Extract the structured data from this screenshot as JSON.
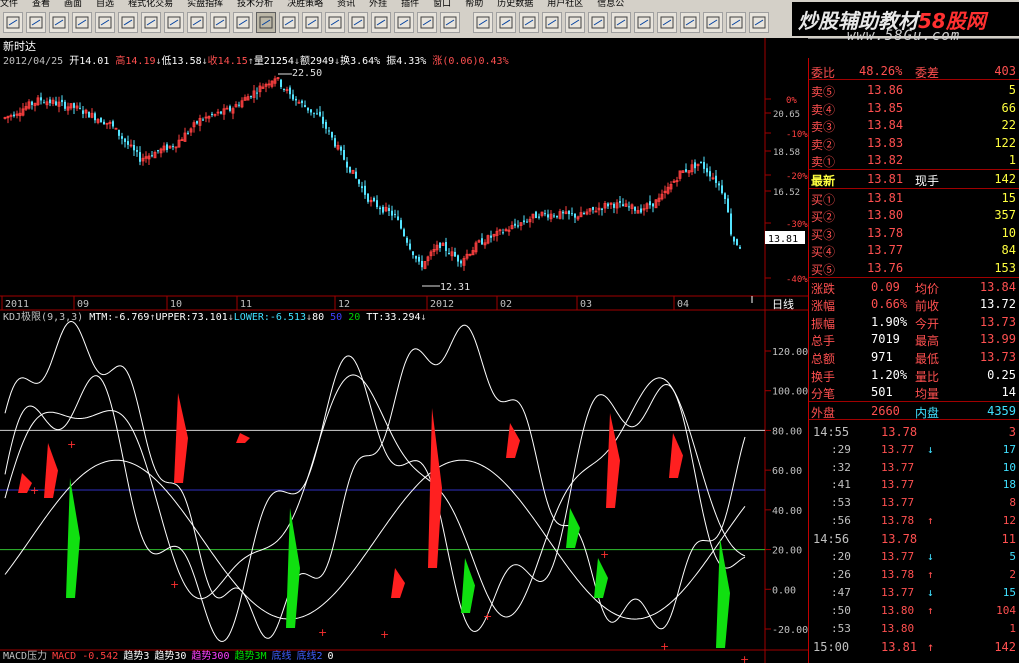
{
  "menu": [
    "文件",
    "查看",
    "画面",
    "自选",
    "程式化交易",
    "实盘指挥",
    "技术分析",
    "决胜策略",
    "资讯",
    "外挂",
    "插件",
    "窗口",
    "帮助",
    "历史数据",
    "用户社区",
    "信息公"
  ],
  "logo": {
    "text_main": "炒股辅助教材",
    "text_red": "58股网",
    "url": "www.58Gu.com"
  },
  "chart": {
    "title": "新时达",
    "info": {
      "date": "2012/04/25",
      "open": "开14.01",
      "high": "高14.19",
      "low": "低13.58",
      "close": "收14.15",
      "vol": "量21254",
      "amt": "额2949",
      "turn": "换3.64%",
      "amp": "振4.33%",
      "chg": "涨(0.06)0.43%"
    },
    "peak_label": "22.50",
    "trough_label": "12.31",
    "right_scale": [
      "0%",
      "20.65",
      "-10%",
      "18.58",
      "-20%",
      "16.52",
      "-30%",
      "13.81",
      "-40%"
    ],
    "last_price": "13.81",
    "months": [
      "2011",
      "09",
      "10",
      "11",
      "12",
      "2012",
      "02",
      "03",
      "04"
    ],
    "period_label": "日线"
  },
  "indicator": {
    "header": "KDJ极限(9,3,3)",
    "mtm": "MTM:-6.769",
    "upper": "UPPER:73.101",
    "lower": "LOWER:-6.513",
    "v80": "80",
    "v50": "50",
    "v20": "20",
    "tt": "TT:33.294",
    "yticks": [
      "120.00",
      "100.00",
      "80.00",
      "60.00",
      "40.00",
      "20.00",
      "0.00",
      "-20.00"
    ]
  },
  "bottom_tabs": [
    {
      "label": "MACD压力",
      "color": "#c0c0c0"
    },
    {
      "label": "MACD -0.542",
      "color": "#ff4040"
    },
    {
      "label": "趋势3",
      "color": "#ffffff"
    },
    {
      "label": "趋势30",
      "color": "#ffffff"
    },
    {
      "label": "趋势300",
      "color": "#ff40ff"
    },
    {
      "label": "趋势3M",
      "color": "#00e000"
    },
    {
      "label": "底线",
      "color": "#4060ff"
    },
    {
      "label": "底线2",
      "color": "#4060ff"
    },
    {
      "label": "0",
      "color": "#ffffff"
    }
  ],
  "panel": {
    "webi": {
      "label": "委比",
      "value": "48.26%",
      "label2": "委差",
      "value2": "403"
    },
    "sell": [
      {
        "label": "卖⑤",
        "price": "13.86",
        "vol": "5"
      },
      {
        "label": "卖④",
        "price": "13.85",
        "vol": "66"
      },
      {
        "label": "卖③",
        "price": "13.84",
        "vol": "22"
      },
      {
        "label": "卖②",
        "price": "13.83",
        "vol": "122"
      },
      {
        "label": "卖①",
        "price": "13.82",
        "vol": "1"
      }
    ],
    "latest": {
      "label": "最新",
      "price": "13.81",
      "label2": "现手",
      "vol": "142"
    },
    "buy": [
      {
        "label": "买①",
        "price": "13.81",
        "vol": "15"
      },
      {
        "label": "买②",
        "price": "13.80",
        "vol": "357"
      },
      {
        "label": "买③",
        "price": "13.78",
        "vol": "10"
      },
      {
        "label": "买④",
        "price": "13.77",
        "vol": "84"
      },
      {
        "label": "买⑤",
        "price": "13.76",
        "vol": "153"
      }
    ],
    "stats": [
      {
        "l1": "涨跌",
        "v1": "0.09",
        "c1": "#ff5050",
        "l2": "均价",
        "v2": "13.84",
        "c2": "#ff5050"
      },
      {
        "l1": "涨幅",
        "v1": "0.66%",
        "c1": "#ff5050",
        "l2": "前收",
        "v2": "13.72",
        "c2": "#ffffff"
      },
      {
        "l1": "振幅",
        "v1": "1.90%",
        "c1": "#ffffff",
        "l2": "今开",
        "v2": "13.73",
        "c2": "#ff5050"
      },
      {
        "l1": "总手",
        "v1": "7019",
        "c1": "#ffffff",
        "l2": "最高",
        "v2": "13.99",
        "c2": "#ff5050"
      },
      {
        "l1": "总额",
        "v1": "971",
        "c1": "#ffffff",
        "l2": "最低",
        "v2": "13.73",
        "c2": "#ff5050"
      },
      {
        "l1": "换手",
        "v1": "1.20%",
        "c1": "#ffffff",
        "l2": "量比",
        "v2": "0.25",
        "c2": "#ffffff"
      },
      {
        "l1": "分笔",
        "v1": "501",
        "c1": "#ffffff",
        "l2": "均量",
        "v2": "14",
        "c2": "#ffffff"
      }
    ],
    "outer": {
      "label": "外盘",
      "value": "2660",
      "label2": "内盘",
      "value2": "4359"
    },
    "ticks": [
      {
        "time": "14:55",
        "price": "13.78",
        "arrow": "",
        "vol": "3",
        "vc": "#ff5050"
      },
      {
        "time": ":29",
        "price": "13.77",
        "arrow": "↓",
        "vol": "17",
        "vc": "#40e0ff"
      },
      {
        "time": ":32",
        "price": "13.77",
        "arrow": "",
        "vol": "10",
        "vc": "#40e0ff"
      },
      {
        "time": ":41",
        "price": "13.77",
        "arrow": "",
        "vol": "18",
        "vc": "#40e0ff"
      },
      {
        "time": ":53",
        "price": "13.77",
        "arrow": "",
        "vol": "8",
        "vc": "#ff5050"
      },
      {
        "time": ":56",
        "price": "13.78",
        "arrow": "↑",
        "vol": "12",
        "vc": "#ff5050"
      },
      {
        "time": "14:56",
        "price": "13.78",
        "arrow": "",
        "vol": "11",
        "vc": "#ff5050"
      },
      {
        "time": ":20",
        "price": "13.77",
        "arrow": "↓",
        "vol": "5",
        "vc": "#40e0ff"
      },
      {
        "time": ":26",
        "price": "13.78",
        "arrow": "↑",
        "vol": "2",
        "vc": "#ff5050"
      },
      {
        "time": ":47",
        "price": "13.77",
        "arrow": "↓",
        "vol": "15",
        "vc": "#40e0ff"
      },
      {
        "time": ":50",
        "price": "13.80",
        "arrow": "↑",
        "vol": "104",
        "vc": "#ff5050"
      },
      {
        "time": ":53",
        "price": "13.80",
        "arrow": "",
        "vol": "1",
        "vc": "#ff5050"
      },
      {
        "time": "15:00",
        "price": "13.81",
        "arrow": "↑",
        "vol": "142",
        "vc": "#ff5050"
      }
    ]
  }
}
